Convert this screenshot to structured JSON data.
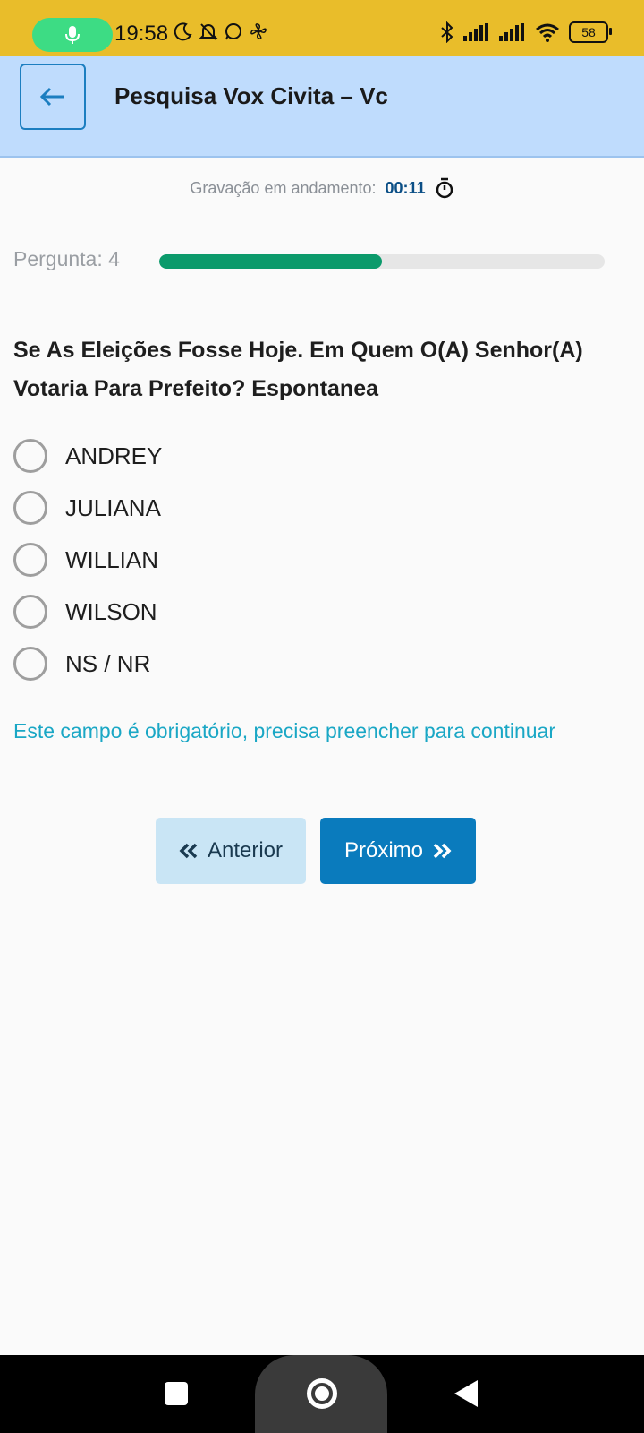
{
  "status_bar": {
    "time": "19:58",
    "battery": "58"
  },
  "app_bar": {
    "title": "Pesquisa Vox Civita – Vc"
  },
  "recording": {
    "label": "Gravação em andamento:",
    "elapsed": "00:11"
  },
  "question": {
    "number_label": "Pergunta: 4",
    "progress_fraction": 0.5,
    "text": "Se As Eleições Fosse Hoje. Em Quem O(A) Senhor(A) Votaria Para Prefeito? Espontanea",
    "options": [
      {
        "label": "ANDREY"
      },
      {
        "label": "JULIANA"
      },
      {
        "label": "WILLIAN"
      },
      {
        "label": "WILSON"
      },
      {
        "label": "NS / NR"
      }
    ],
    "required_message": "Este campo é obrigatório, precisa preencher para continuar"
  },
  "buttons": {
    "previous": "Anterior",
    "next": "Próximo"
  },
  "colors": {
    "status_bar": "#e9bd2a",
    "app_bar": "#bfdcfd",
    "progress": "#0b9a6b",
    "accent": "#0a7bbd",
    "required": "#1aa7c5"
  }
}
